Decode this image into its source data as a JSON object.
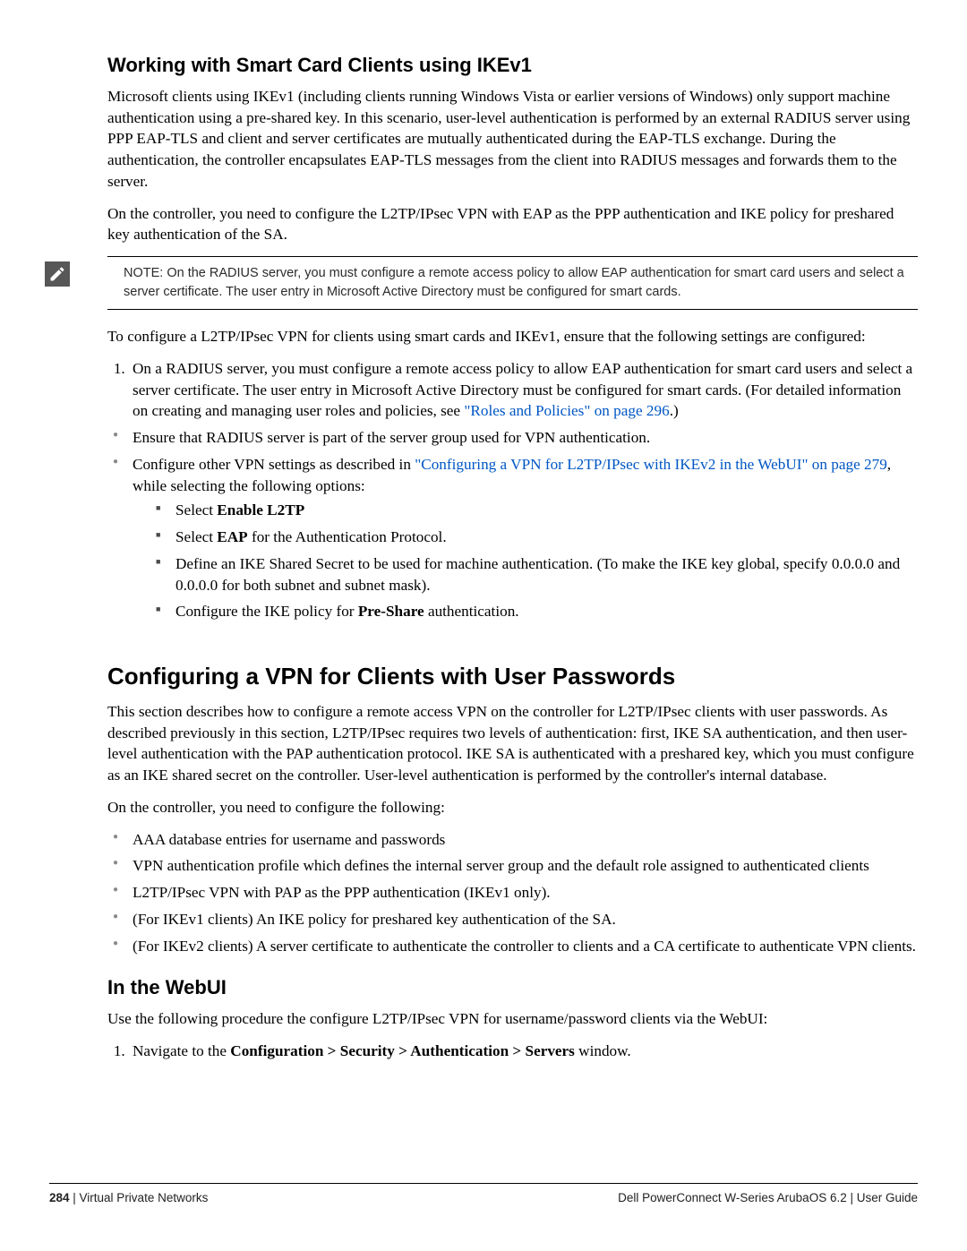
{
  "section1": {
    "heading": "Working with Smart Card Clients using IKEv1",
    "p1": "Microsoft clients using IKEv1 (including clients running Windows Vista or earlier versions of Windows) only support machine authentication using a pre-shared key. In this scenario, user-level authentication is performed by an external RADIUS server using PPP EAP-TLS and client and server certificates are mutually authenticated during the EAP-TLS exchange. During the authentication, the controller encapsulates EAP-TLS messages from the client into RADIUS messages and forwards them to the server.",
    "p2": "On the controller, you need to configure the L2TP/IPsec VPN with EAP as the PPP authentication and IKE policy for preshared key authentication of the SA.",
    "note": "NOTE: On the RADIUS server, you must configure a remote access policy to allow EAP authentication for smart card users and select a server certificate. The user entry in Microsoft Active Directory must be configured for smart cards.",
    "p3": "To configure a L2TP/IPsec VPN for clients using smart cards and IKEv1, ensure that the following settings are configured:",
    "ol1": {
      "pre": "On a RADIUS server, you must configure a remote access policy to allow EAP authentication for smart card users and select a server certificate. The user entry in Microsoft Active Directory must be configured for smart cards. (For detailed information on creating and managing user roles and policies, see ",
      "link": "\"Roles and Policies\" on page 296",
      "post": ".)"
    },
    "ul": {
      "b1": "Ensure that RADIUS server is part of the server group used for VPN authentication.",
      "b2pre": "Configure other VPN settings as described in ",
      "b2link": "\"Configuring a VPN for L2TP/IPsec with IKEv2 in the WebUI\" on page 279",
      "b2post": ", while selecting the following options:",
      "sq1pre": "Select ",
      "sq1b": "Enable L2TP",
      "sq2pre": "Select ",
      "sq2b": "EAP",
      "sq2post": " for the Authentication Protocol.",
      "sq3": "Define an IKE Shared Secret to be used for machine authentication. (To make the IKE key global, specify 0.0.0.0 and 0.0.0.0 for both subnet and subnet mask).",
      "sq4pre": "Configure the IKE policy for ",
      "sq4b": "Pre-Share",
      "sq4post": " authentication."
    }
  },
  "section2": {
    "heading": "Configuring a VPN for Clients with User Passwords",
    "p1": "This section describes how to configure a remote access VPN on the controller for L2TP/IPsec clients with user passwords. As described previously in this section, L2TP/IPsec requires two levels of authentication: first, IKE SA authentication, and then user-level authentication with the PAP authentication protocol. IKE SA is authenticated with a preshared key, which you must configure as an IKE shared secret on the controller. User-level authentication is performed by the controller's internal database.",
    "p2": "On the controller, you need to configure the following:",
    "ul": {
      "b1": "AAA database entries for username and passwords",
      "b2": "VPN authentication profile which defines the internal server group and the default role assigned to authenticated clients",
      "b3": "L2TP/IPsec VPN with PAP as the PPP authentication (IKEv1 only).",
      "b4": "(For IKEv1 clients) An IKE policy for preshared key authentication of the SA.",
      "b5": "(For IKEv2 clients) A server certificate to authenticate the controller to clients and a CA certificate to authenticate VPN clients."
    }
  },
  "section3": {
    "heading": "In the WebUI",
    "p1": "Use the following procedure the configure L2TP/IPsec VPN for username/password clients via the WebUI:",
    "ol1pre": "Navigate to the ",
    "ol1b": "Configuration > Security > Authentication > Servers",
    "ol1post": " window."
  },
  "footer": {
    "page": "284",
    "leftLabel": " | Virtual Private Networks",
    "right": "Dell PowerConnect W-Series ArubaOS 6.2  |  User Guide"
  }
}
